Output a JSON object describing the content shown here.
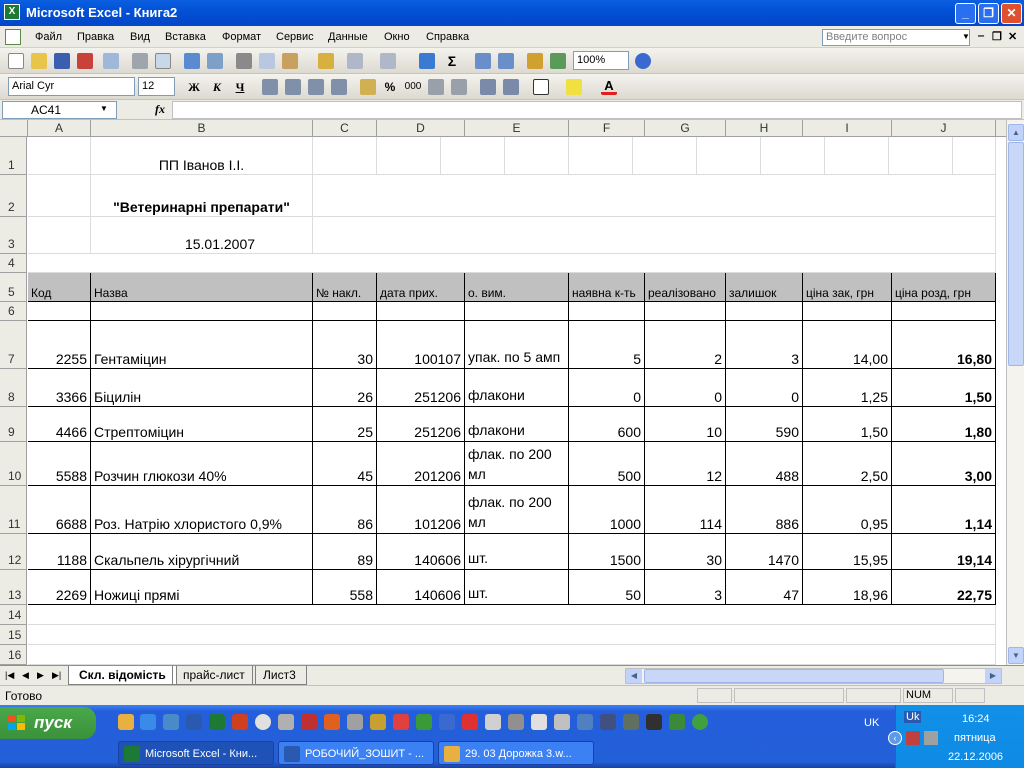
{
  "window": {
    "title": "Microsoft Excel - Книга2"
  },
  "menu": {
    "items": [
      "Файл",
      "Правка",
      "Вид",
      "Вставка",
      "Формат",
      "Сервис",
      "Данные",
      "Окно",
      "Справка"
    ],
    "ask_placeholder": "Введите вопрос"
  },
  "toolbar": {
    "zoom": "100%",
    "font": "Arial Cyr",
    "font_size": "12",
    "bold": "Ж",
    "italic": "К",
    "underline": "Ч",
    "percent": "%",
    "thousands": "000"
  },
  "namebox": {
    "ref": "AC41",
    "fx": "fx"
  },
  "columns": [
    "A",
    "B",
    "C",
    "D",
    "E",
    "F",
    "G",
    "H",
    "I",
    "J"
  ],
  "rows": [
    "1",
    "2",
    "3",
    "4",
    "5",
    "6",
    "7",
    "8",
    "9",
    "10",
    "11",
    "12",
    "13",
    "14",
    "15",
    "16"
  ],
  "sheet": {
    "company": "ПП Іванов І.І.",
    "heading": "\"Ветеринарні препарати\"",
    "date": "15.01.2007",
    "headers": [
      "Код",
      "Назва",
      "№ накл.",
      "дата прих.",
      "о. вим.",
      "наявна к-ть",
      "реалізовано",
      "залишок",
      "ціна зак, грн",
      "ціна розд, грн"
    ],
    "data": [
      [
        "2255",
        "Гентаміцин",
        "30",
        "100107",
        "упак. по 5 амп",
        "5",
        "2",
        "3",
        "14,00",
        "16,80"
      ],
      [
        "3366",
        "Біцилін",
        "26",
        "251206",
        "флакони",
        "0",
        "0",
        "0",
        "1,25",
        "1,50"
      ],
      [
        "4466",
        "Стрептоміцин",
        "25",
        "251206",
        "флакони",
        "600",
        "10",
        "590",
        "1,50",
        "1,80"
      ],
      [
        "5588",
        "Розчин глюкози 40%",
        "45",
        "201206",
        "флак. по 200 мл",
        "500",
        "12",
        "488",
        "2,50",
        "3,00"
      ],
      [
        "6688",
        "Роз. Натрію хлористого 0,9%",
        "86",
        "101206",
        "флак. по 200 мл",
        "1000",
        "114",
        "886",
        "0,95",
        "1,14"
      ],
      [
        "1188",
        "Скальпель хірургічний",
        "89",
        "140606",
        "шт.",
        "1500",
        "30",
        "1470",
        "15,95",
        "19,14"
      ],
      [
        "2269",
        "Ножиці прямі",
        "558",
        "140606",
        "шт.",
        "50",
        "3",
        "47",
        "18,96",
        "22,75"
      ]
    ]
  },
  "tabs": [
    "Скл. відомість",
    "прайс-лист",
    "Лист3"
  ],
  "status": {
    "left": "Готово",
    "num": "NUM"
  },
  "taskbar": {
    "start": "пуск",
    "lang": "UK",
    "tray_lang": "Uk",
    "tasks": [
      "Microsoft Excel - Кни...",
      "РОБОЧИЙ_ЗОШИТ - ...",
      "29. 03 Дорожка 3.w..."
    ],
    "time": "16:24",
    "day": "пятница",
    "date": "22.12.2006"
  }
}
